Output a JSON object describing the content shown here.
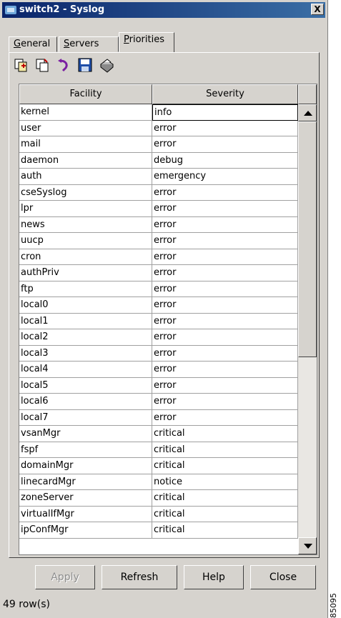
{
  "window": {
    "title": "switch2 - Syslog",
    "close_label": "X"
  },
  "tabs": [
    {
      "label": "General",
      "u": "G",
      "rest": "eneral"
    },
    {
      "label": "Servers",
      "u": "S",
      "rest": "ervers"
    },
    {
      "label": "Priorities",
      "u": "P",
      "rest": "riorities",
      "active": true
    }
  ],
  "toolbar": [
    {
      "icon": "copy-row-icon"
    },
    {
      "icon": "paste-row-icon"
    },
    {
      "icon": "undo-icon"
    },
    {
      "icon": "save-icon"
    },
    {
      "icon": "print-icon"
    }
  ],
  "table": {
    "headers": [
      "Facility",
      "Severity"
    ],
    "rows": [
      [
        "kernel",
        "info"
      ],
      [
        "user",
        "error"
      ],
      [
        "mail",
        "error"
      ],
      [
        "daemon",
        "debug"
      ],
      [
        "auth",
        "emergency"
      ],
      [
        "cseSyslog",
        "error"
      ],
      [
        "lpr",
        "error"
      ],
      [
        "news",
        "error"
      ],
      [
        "uucp",
        "error"
      ],
      [
        "cron",
        "error"
      ],
      [
        "authPriv",
        "error"
      ],
      [
        "ftp",
        "error"
      ],
      [
        "local0",
        "error"
      ],
      [
        "local1",
        "error"
      ],
      [
        "local2",
        "error"
      ],
      [
        "local3",
        "error"
      ],
      [
        "local4",
        "error"
      ],
      [
        "local5",
        "error"
      ],
      [
        "local6",
        "error"
      ],
      [
        "local7",
        "error"
      ],
      [
        "vsanMgr",
        "critical"
      ],
      [
        "fspf",
        "critical"
      ],
      [
        "domainMgr",
        "critical"
      ],
      [
        "linecardMgr",
        "notice"
      ],
      [
        "zoneServer",
        "critical"
      ],
      [
        "virtualIfMgr",
        "critical"
      ],
      [
        "ipConfMgr",
        "critical"
      ]
    ]
  },
  "buttons": {
    "apply": "Apply",
    "refresh": "Refresh",
    "help": "Help",
    "close": "Close"
  },
  "status": "49 row(s)",
  "figure_id": "85095"
}
